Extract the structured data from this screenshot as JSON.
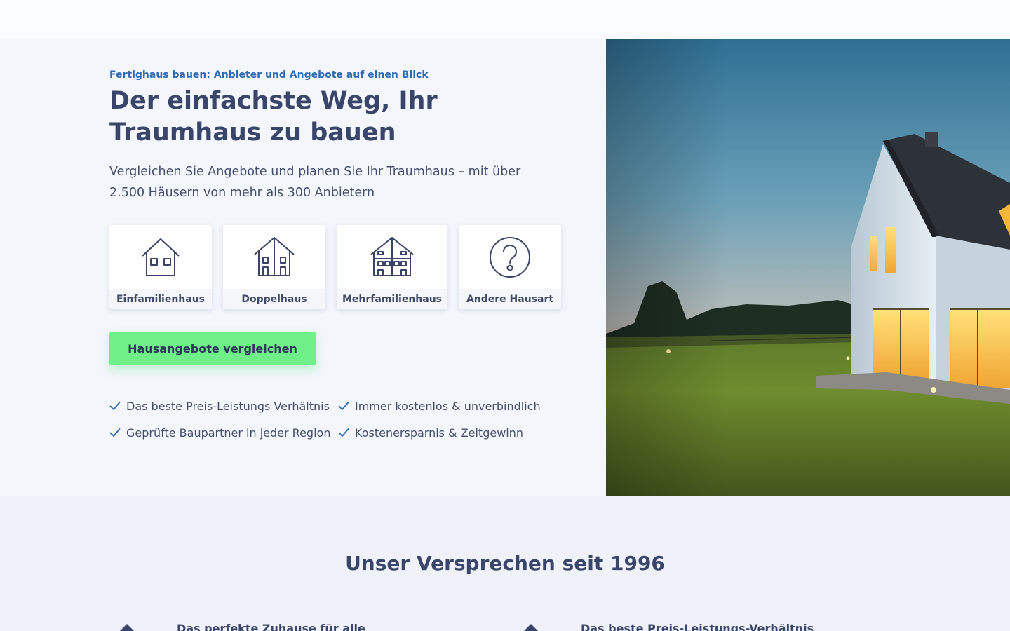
{
  "hero": {
    "eyebrow": "Fertighaus bauen: Anbieter und Angebote auf einen Blick",
    "headline": "Der einfachste Weg, Ihr Traumhaus zu bauen",
    "subline": "Vergleichen Sie Angebote und planen Sie Ihr Traumhaus – mit über 2.500 Häusern von mehr als 300 Anbietern",
    "house_types": [
      {
        "label": "Einfamilienhaus",
        "icon": "single-family-house-icon"
      },
      {
        "label": "Doppelhaus",
        "icon": "semi-detached-house-icon"
      },
      {
        "label": "Mehrfamilienhaus",
        "icon": "multi-family-house-icon"
      },
      {
        "label": "Andere Hausart",
        "icon": "question-mark-icon"
      }
    ],
    "cta_label": "Hausangebote vergleichen",
    "benefits": [
      "Das beste Preis-Leistungs Verhältnis",
      "Immer kostenlos & unverbindlich",
      "Geprüfte Baupartner in jeder Region",
      "Kostenersparnis & Zeitgewinn"
    ],
    "image": "modern-house-at-dusk-photo"
  },
  "promise": {
    "title": "Unser Versprechen seit 1996",
    "features": [
      "Das perfekte Zuhause für alle",
      "Das beste Preis-Leistungs-Verhältnis"
    ]
  },
  "colors": {
    "accent_blue": "#2f6ab4",
    "text_dark": "#39456a",
    "cta_green": "#6ff089",
    "check": "#2f6ab4"
  }
}
